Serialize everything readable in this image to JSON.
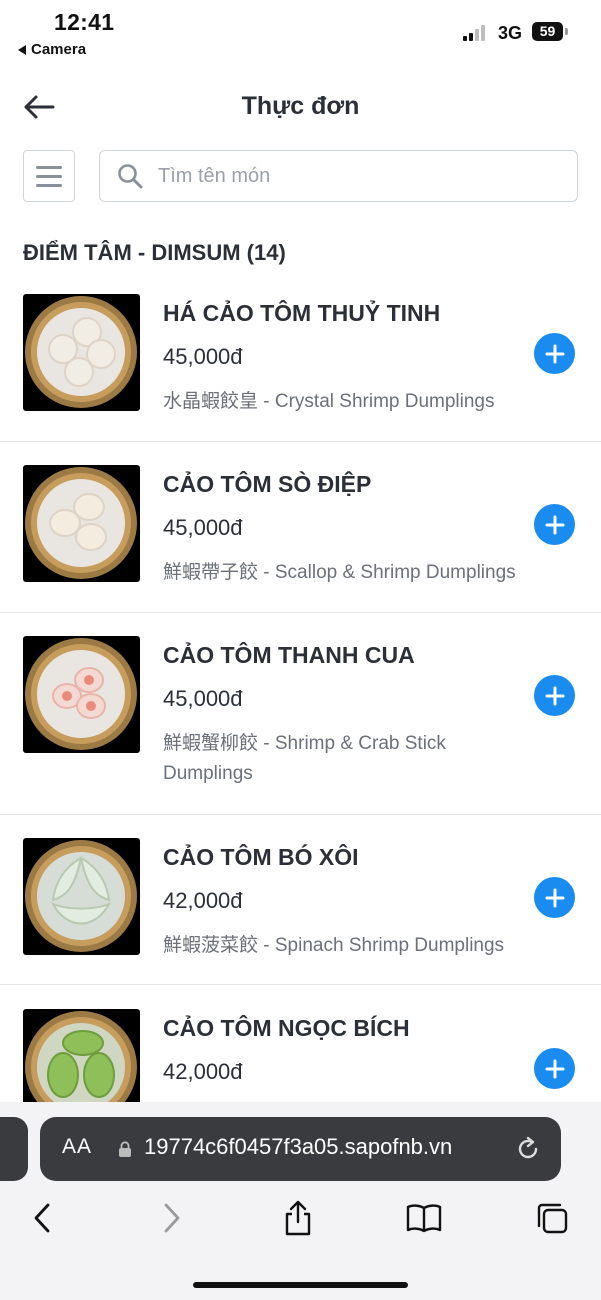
{
  "status_bar": {
    "time": "12:41",
    "back_app": "Camera",
    "network": "3G",
    "battery": "59"
  },
  "header": {
    "title": "Thực đơn"
  },
  "search": {
    "placeholder": "Tìm tên món"
  },
  "category": {
    "title": "ĐIỂM TÂM - DIMSUM (14)"
  },
  "items": [
    {
      "name": "HÁ CẢO TÔM THUỶ TINH",
      "price": "45,000đ",
      "description": "水晶蝦餃皇 - Crystal Shrimp Dumplings",
      "dumpling_color": "#f1ece4"
    },
    {
      "name": "CẢO TÔM SÒ ĐIỆP",
      "price": "45,000đ",
      "description": "鮮蝦帶子餃 - Scallop & Shrimp Dumplings",
      "dumpling_color": "#f3ecdf"
    },
    {
      "name": "CẢO TÔM THANH CUA",
      "price": "45,000đ",
      "description": "鮮蝦蟹柳餃 - Shrimp & Crab Stick Dumplings",
      "dumpling_color": "#f4d9d3"
    },
    {
      "name": "CẢO TÔM BÓ XÔI",
      "price": "42,000đ",
      "description": "鮮蝦菠菜餃 - Spinach Shrimp Dumplings",
      "dumpling_color": "#e3ece0"
    },
    {
      "name": "CẢO TÔM NGỌC BÍCH",
      "price": "42,000đ",
      "description": "",
      "dumpling_color": "#8fbf58"
    }
  ],
  "browser": {
    "aa_label": "AA",
    "url": "19774c6f0457f3a05.sapofnb.vn"
  },
  "colors": {
    "accent": "#1a8cf0",
    "text": "#2b2f38",
    "muted": "#6b7079"
  }
}
